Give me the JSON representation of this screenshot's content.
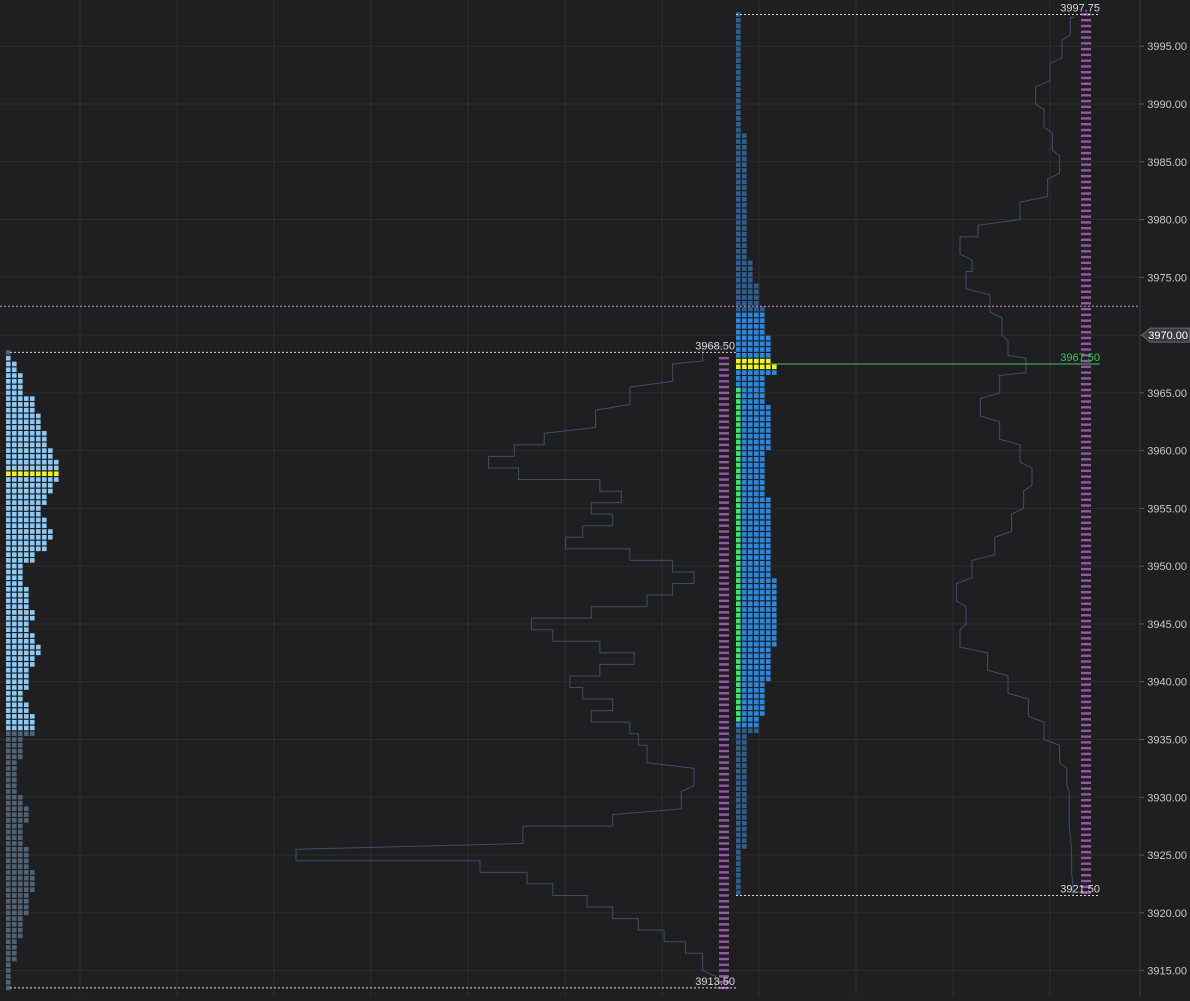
{
  "colors": {
    "background": "#1f1f21",
    "grid": "#2c2d31",
    "axis_text": "#c9c9c9",
    "tpo_light": "#8fc8f2",
    "tpo_dim": "#4f6375",
    "tpo_blue": "#2c86d9",
    "tpo_dark": "#2e5f8c",
    "poc": "#f2ef2b",
    "initial_balance": "#3fe36f",
    "volume_outline": "#3a4f6b",
    "volume_labels": "#c06ad8",
    "ref_line": "#d9d9d9",
    "green_line": "#38c75a",
    "magenta_line": "#cf8fd6",
    "current_price_badge": "#3a3b3f"
  },
  "chart_data": {
    "type": "market-profile",
    "title": "",
    "ylabel": "",
    "ylim": [
      3912.8,
      3999.0
    ],
    "tick_size": 0.25,
    "y_ticks": [
      "3995.00",
      "3990.00",
      "3985.00",
      "3980.00",
      "3975.00",
      "3970.00",
      "3965.00",
      "3960.00",
      "3955.00",
      "3950.00",
      "3945.00",
      "3940.00",
      "3935.00",
      "3930.00",
      "3925.00",
      "3920.00",
      "3915.00"
    ],
    "current_price": "3970.00",
    "annotations": [
      "3997.75",
      "3968.50",
      "3967.50",
      "3921.50",
      "3913.50"
    ],
    "profiles": [
      {
        "name": "",
        "high": 3968.5,
        "low": 3913.5,
        "poc": 3958.0,
        "value_area_high": 3968.0,
        "value_area_low": 3936.0,
        "tpo_width_profile": [
          {
            "price": 3968.5,
            "count": 1
          },
          {
            "price": 3967.5,
            "count": 2
          },
          {
            "price": 3966.0,
            "count": 3
          },
          {
            "price": 3964.0,
            "count": 5
          },
          {
            "price": 3963.0,
            "count": 6
          },
          {
            "price": 3961.0,
            "count": 7
          },
          {
            "price": 3960.0,
            "count": 8
          },
          {
            "price": 3959.0,
            "count": 9
          },
          {
            "price": 3958.0,
            "count": 9
          },
          {
            "price": 3957.0,
            "count": 8
          },
          {
            "price": 3956.0,
            "count": 7
          },
          {
            "price": 3955.0,
            "count": 6
          },
          {
            "price": 3954.0,
            "count": 7
          },
          {
            "price": 3953.0,
            "count": 8
          },
          {
            "price": 3952.0,
            "count": 7
          },
          {
            "price": 3951.0,
            "count": 5
          },
          {
            "price": 3950.0,
            "count": 3
          },
          {
            "price": 3949.0,
            "count": 3
          },
          {
            "price": 3948.0,
            "count": 4
          },
          {
            "price": 3947.0,
            "count": 4
          },
          {
            "price": 3946.0,
            "count": 5
          },
          {
            "price": 3945.0,
            "count": 4
          },
          {
            "price": 3944.0,
            "count": 5
          },
          {
            "price": 3943.0,
            "count": 6
          },
          {
            "price": 3942.0,
            "count": 5
          },
          {
            "price": 3941.0,
            "count": 4
          },
          {
            "price": 3940.0,
            "count": 4
          },
          {
            "price": 3939.0,
            "count": 3
          },
          {
            "price": 3938.0,
            "count": 4
          },
          {
            "price": 3937.0,
            "count": 5
          },
          {
            "price": 3936.0,
            "count": 5
          },
          {
            "price": 3935.0,
            "count": 3
          },
          {
            "price": 3934.0,
            "count": 3
          },
          {
            "price": 3933.0,
            "count": 2
          },
          {
            "price": 3931.0,
            "count": 2
          },
          {
            "price": 3930.0,
            "count": 3
          },
          {
            "price": 3929.0,
            "count": 4
          },
          {
            "price": 3927.0,
            "count": 3
          },
          {
            "price": 3925.0,
            "count": 4
          },
          {
            "price": 3923.0,
            "count": 5
          },
          {
            "price": 3921.0,
            "count": 4
          },
          {
            "price": 3919.0,
            "count": 3
          },
          {
            "price": 3917.0,
            "count": 2
          },
          {
            "price": 3915.0,
            "count": 1
          },
          {
            "price": 3913.5,
            "count": 1
          }
        ],
        "volume_profile": [
          {
            "price": 3968.5,
            "volume": 0.05
          },
          {
            "price": 3967.0,
            "volume": 0.12
          },
          {
            "price": 3965.0,
            "volume": 0.22
          },
          {
            "price": 3963.0,
            "volume": 0.3
          },
          {
            "price": 3961.0,
            "volume": 0.42
          },
          {
            "price": 3960.0,
            "volume": 0.49
          },
          {
            "price": 3959.0,
            "volume": 0.55
          },
          {
            "price": 3958.0,
            "volume": 0.48
          },
          {
            "price": 3957.0,
            "volume": 0.29
          },
          {
            "price": 3956.0,
            "volume": 0.24
          },
          {
            "price": 3955.0,
            "volume": 0.31
          },
          {
            "price": 3954.0,
            "volume": 0.26
          },
          {
            "price": 3953.0,
            "volume": 0.33
          },
          {
            "price": 3952.0,
            "volume": 0.37
          },
          {
            "price": 3951.0,
            "volume": 0.22
          },
          {
            "price": 3950.0,
            "volume": 0.12
          },
          {
            "price": 3949.0,
            "volume": 0.07
          },
          {
            "price": 3948.0,
            "volume": 0.12
          },
          {
            "price": 3947.0,
            "volume": 0.18
          },
          {
            "price": 3946.0,
            "volume": 0.31
          },
          {
            "price": 3945.0,
            "volume": 0.45
          },
          {
            "price": 3944.0,
            "volume": 0.4
          },
          {
            "price": 3943.0,
            "volume": 0.29
          },
          {
            "price": 3942.0,
            "volume": 0.21
          },
          {
            "price": 3941.0,
            "volume": 0.29
          },
          {
            "price": 3940.0,
            "volume": 0.36
          },
          {
            "price": 3939.0,
            "volume": 0.33
          },
          {
            "price": 3938.0,
            "volume": 0.26
          },
          {
            "price": 3937.0,
            "volume": 0.31
          },
          {
            "price": 3936.0,
            "volume": 0.22
          },
          {
            "price": 3935.0,
            "volume": 0.2
          },
          {
            "price": 3934.0,
            "volume": 0.18
          },
          {
            "price": 3932.0,
            "volume": 0.07
          },
          {
            "price": 3930.0,
            "volume": 0.1
          },
          {
            "price": 3928.0,
            "volume": 0.26
          },
          {
            "price": 3927.0,
            "volume": 0.47
          },
          {
            "price": 3925.0,
            "volume": 1.0
          },
          {
            "price": 3924.0,
            "volume": 0.57
          },
          {
            "price": 3923.0,
            "volume": 0.46
          },
          {
            "price": 3922.0,
            "volume": 0.4
          },
          {
            "price": 3921.0,
            "volume": 0.32
          },
          {
            "price": 3920.0,
            "volume": 0.26
          },
          {
            "price": 3919.0,
            "volume": 0.2
          },
          {
            "price": 3918.0,
            "volume": 0.14
          },
          {
            "price": 3917.0,
            "volume": 0.09
          },
          {
            "price": 3916.0,
            "volume": 0.05
          },
          {
            "price": 3914.0,
            "volume": 0.02
          }
        ]
      },
      {
        "name": "",
        "high": 3997.75,
        "low": 3921.5,
        "poc": 3967.5,
        "value_area_high": 3972.0,
        "value_area_low": 3936.0,
        "initial_balance_high": 3965.5,
        "initial_balance_low": 3936.5,
        "tpo_width_profile": [
          {
            "price": 3997.75,
            "count": 1
          },
          {
            "price": 3977.0,
            "count": 2
          },
          {
            "price": 3976.0,
            "count": 3
          },
          {
            "price": 3973.0,
            "count": 4
          },
          {
            "price": 3972.0,
            "count": 5
          },
          {
            "price": 3968.0,
            "count": 6
          },
          {
            "price": 3967.5,
            "count": 7
          },
          {
            "price": 3966.0,
            "count": 5
          },
          {
            "price": 3962.0,
            "count": 6
          },
          {
            "price": 3958.0,
            "count": 5
          },
          {
            "price": 3954.0,
            "count": 6
          },
          {
            "price": 3950.0,
            "count": 6
          },
          {
            "price": 3948.0,
            "count": 7
          },
          {
            "price": 3944.0,
            "count": 7
          },
          {
            "price": 3942.0,
            "count": 6
          },
          {
            "price": 3938.0,
            "count": 5
          },
          {
            "price": 3936.0,
            "count": 4
          },
          {
            "price": 3935.0,
            "count": 2
          },
          {
            "price": 3930.0,
            "count": 2
          },
          {
            "price": 3921.5,
            "count": 1
          }
        ],
        "volume_profile": [
          {
            "price": 3997.0,
            "volume": 0.03
          },
          {
            "price": 3995.0,
            "volume": 0.1
          },
          {
            "price": 3993.0,
            "volume": 0.2
          },
          {
            "price": 3991.0,
            "volume": 0.32
          },
          {
            "price": 3989.0,
            "volume": 0.25
          },
          {
            "price": 3987.0,
            "volume": 0.18
          },
          {
            "price": 3985.0,
            "volume": 0.12
          },
          {
            "price": 3983.0,
            "volume": 0.22
          },
          {
            "price": 3981.0,
            "volume": 0.45
          },
          {
            "price": 3979.0,
            "volume": 0.8
          },
          {
            "price": 3978.0,
            "volume": 0.95
          },
          {
            "price": 3976.0,
            "volume": 0.85
          },
          {
            "price": 3975.0,
            "volume": 0.9
          },
          {
            "price": 3973.0,
            "volume": 0.7
          },
          {
            "price": 3971.0,
            "volume": 0.6
          },
          {
            "price": 3969.0,
            "volume": 0.55
          },
          {
            "price": 3967.5,
            "volume": 0.4
          },
          {
            "price": 3966.0,
            "volume": 0.62
          },
          {
            "price": 3964.0,
            "volume": 0.78
          },
          {
            "price": 3962.0,
            "volume": 0.62
          },
          {
            "price": 3960.0,
            "volume": 0.45
          },
          {
            "price": 3958.0,
            "volume": 0.35
          },
          {
            "price": 3956.0,
            "volume": 0.42
          },
          {
            "price": 3954.0,
            "volume": 0.52
          },
          {
            "price": 3952.0,
            "volume": 0.66
          },
          {
            "price": 3950.0,
            "volume": 0.85
          },
          {
            "price": 3948.0,
            "volume": 0.98
          },
          {
            "price": 3946.0,
            "volume": 0.9
          },
          {
            "price": 3944.0,
            "volume": 0.95
          },
          {
            "price": 3942.0,
            "volume": 0.72
          },
          {
            "price": 3940.0,
            "volume": 0.55
          },
          {
            "price": 3938.0,
            "volume": 0.38
          },
          {
            "price": 3936.0,
            "volume": 0.25
          },
          {
            "price": 3934.0,
            "volume": 0.12
          },
          {
            "price": 3932.0,
            "volume": 0.06
          },
          {
            "price": 3930.0,
            "volume": 0.04
          },
          {
            "price": 3925.0,
            "volume": 0.02
          },
          {
            "price": 3922.0,
            "volume": 0.01
          }
        ]
      }
    ]
  }
}
